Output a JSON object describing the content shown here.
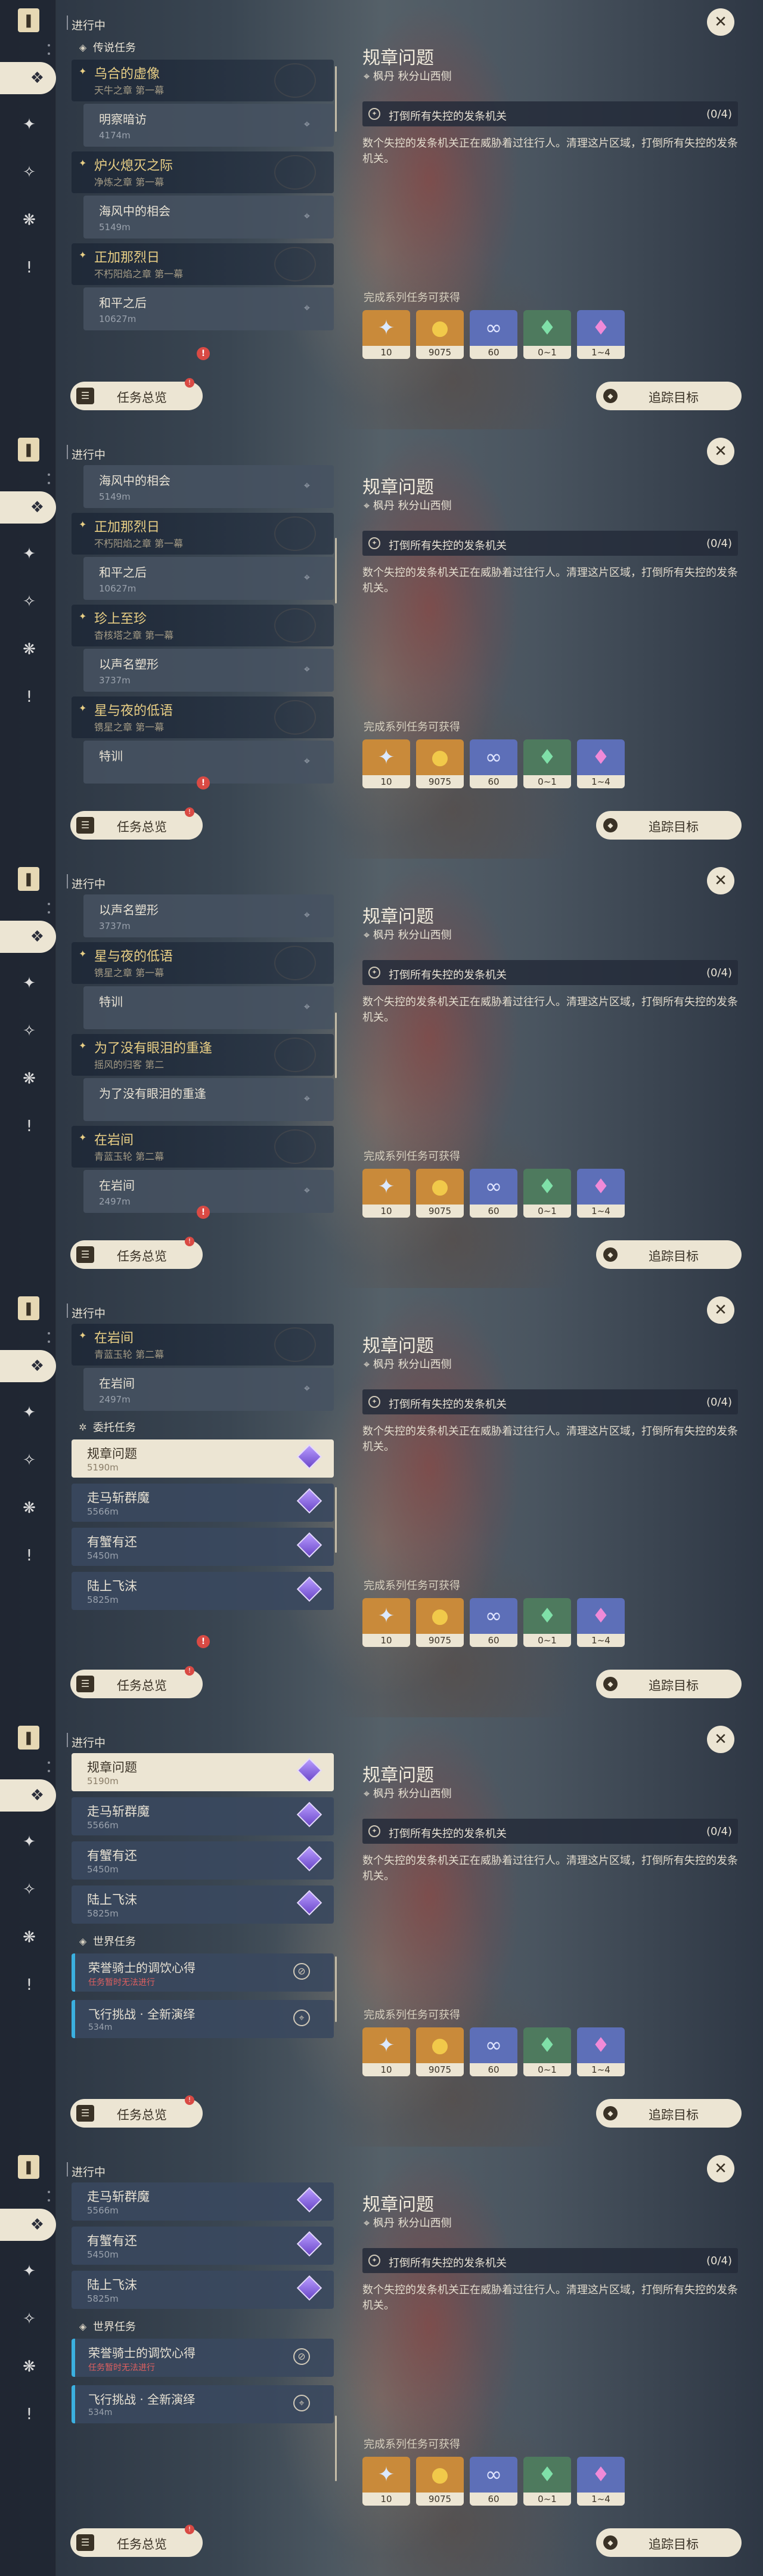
{
  "shared": {
    "status": "进行中",
    "overview_label": "任务总览",
    "track_label": "追踪目标",
    "close_glyph": "✕",
    "detail": {
      "title": "规章问题",
      "location": "枫丹 秋分山西侧",
      "objective": "打倒所有失控的发条机关",
      "progress": "(0/4)",
      "description": "数个失控的发条机关正在威胁着过往行人。清理这片区域，打倒所有失控的发条机关。",
      "rewards_label": "完成系列任务可获得",
      "rewards": [
        {
          "name": "adventure-exp-icon",
          "count": "10"
        },
        {
          "name": "mora-icon",
          "count": "9075"
        },
        {
          "name": "companionship-exp-icon",
          "count": "60"
        },
        {
          "name": "crystal-icon",
          "count": "0~1"
        },
        {
          "name": "crystal-cluster-icon",
          "count": "1~4"
        }
      ]
    },
    "colors": {
      "accent": "#e9cf85",
      "panel": "#ece5d3",
      "world_bar": "#3bb0e0",
      "alert": "#d94a44"
    }
  },
  "screens": [
    {
      "rows": [
        {
          "type": "section",
          "label": "传说任务",
          "icon": "legend-quest-icon"
        },
        {
          "type": "group",
          "title": "乌合的虚像",
          "sub": "天牛之章 第一幕"
        },
        {
          "type": "item",
          "title": "明察暗访",
          "sub": "4174m"
        },
        {
          "type": "group",
          "title": "炉火熄灭之际",
          "sub": "净炼之章 第一幕"
        },
        {
          "type": "item",
          "title": "海风中的相会",
          "sub": "5149m"
        },
        {
          "type": "group",
          "title": "正加那烈日",
          "sub": "不朽阳焰之章 第一幕"
        },
        {
          "type": "item",
          "title": "和平之后",
          "sub": "10627m"
        }
      ]
    },
    {
      "rows": [
        {
          "type": "item",
          "title": "海风中的相会",
          "sub": "5149m"
        },
        {
          "type": "group",
          "title": "正加那烈日",
          "sub": "不朽阳焰之章 第一幕"
        },
        {
          "type": "item",
          "title": "和平之后",
          "sub": "10627m"
        },
        {
          "type": "group",
          "title": "珍上至珍",
          "sub": "杳核塔之章 第一幕"
        },
        {
          "type": "item",
          "title": "以声名塑形",
          "sub": "3737m"
        },
        {
          "type": "group",
          "title": "星与夜的低语",
          "sub": "镌星之章 第一幕"
        },
        {
          "type": "item",
          "title": "特训",
          "sub": ""
        }
      ]
    },
    {
      "rows": [
        {
          "type": "item",
          "title": "以声名塑形",
          "sub": "3737m"
        },
        {
          "type": "group",
          "title": "星与夜的低语",
          "sub": "镌星之章 第一幕"
        },
        {
          "type": "item",
          "title": "特训",
          "sub": ""
        },
        {
          "type": "group",
          "title": "为了没有眼泪的重逢",
          "sub": "摇风的归客 第二"
        },
        {
          "type": "item",
          "title": "为了没有眼泪的重逢",
          "sub": ""
        },
        {
          "type": "group",
          "title": "在岩间",
          "sub": "青蓝玉轮 第二幕"
        },
        {
          "type": "item",
          "title": "在岩间",
          "sub": "2497m"
        }
      ]
    },
    {
      "rows": [
        {
          "type": "group",
          "title": "在岩间",
          "sub": "青蓝玉轮 第二幕"
        },
        {
          "type": "item",
          "title": "在岩间",
          "sub": "2497m"
        },
        {
          "type": "section",
          "label": "委托任务",
          "icon": "commission-icon"
        },
        {
          "type": "bar",
          "title": "规章问题",
          "sub": "5190m",
          "selected": true
        },
        {
          "type": "bar",
          "title": "走马斩群魔",
          "sub": "5566m"
        },
        {
          "type": "bar",
          "title": "有蟹有还",
          "sub": "5450m"
        },
        {
          "type": "bar",
          "title": "陆上飞沫",
          "sub": "5825m"
        }
      ]
    },
    {
      "rows": [
        {
          "type": "bar",
          "title": "规章问题",
          "sub": "5190m",
          "selected": true
        },
        {
          "type": "bar",
          "title": "走马斩群魔",
          "sub": "5566m"
        },
        {
          "type": "bar",
          "title": "有蟹有还",
          "sub": "5450m"
        },
        {
          "type": "bar",
          "title": "陆上飞沫",
          "sub": "5825m"
        },
        {
          "type": "section",
          "label": "世界任务",
          "icon": "world-quest-icon"
        },
        {
          "type": "world",
          "title": "荣誉骑士的调饮心得",
          "sub": "任务暂时无法进行",
          "action": "⊘",
          "red": true
        },
        {
          "type": "world",
          "title": "飞行挑战 · 全新演绎",
          "sub": "534m",
          "action": "⌖",
          "red": false
        }
      ]
    },
    {
      "rows": [
        {
          "type": "bar",
          "title": "走马斩群魔",
          "sub": "5566m"
        },
        {
          "type": "bar",
          "title": "有蟹有还",
          "sub": "5450m"
        },
        {
          "type": "bar",
          "title": "陆上飞沫",
          "sub": "5825m"
        },
        {
          "type": "section",
          "label": "世界任务",
          "icon": "world-quest-icon"
        },
        {
          "type": "world",
          "title": "荣誉骑士的调饮心得",
          "sub": "任务暂时无法进行",
          "action": "⊘",
          "red": true
        },
        {
          "type": "world",
          "title": "飞行挑战 · 全新演绎",
          "sub": "534m",
          "action": "⌖",
          "red": false
        }
      ]
    }
  ]
}
